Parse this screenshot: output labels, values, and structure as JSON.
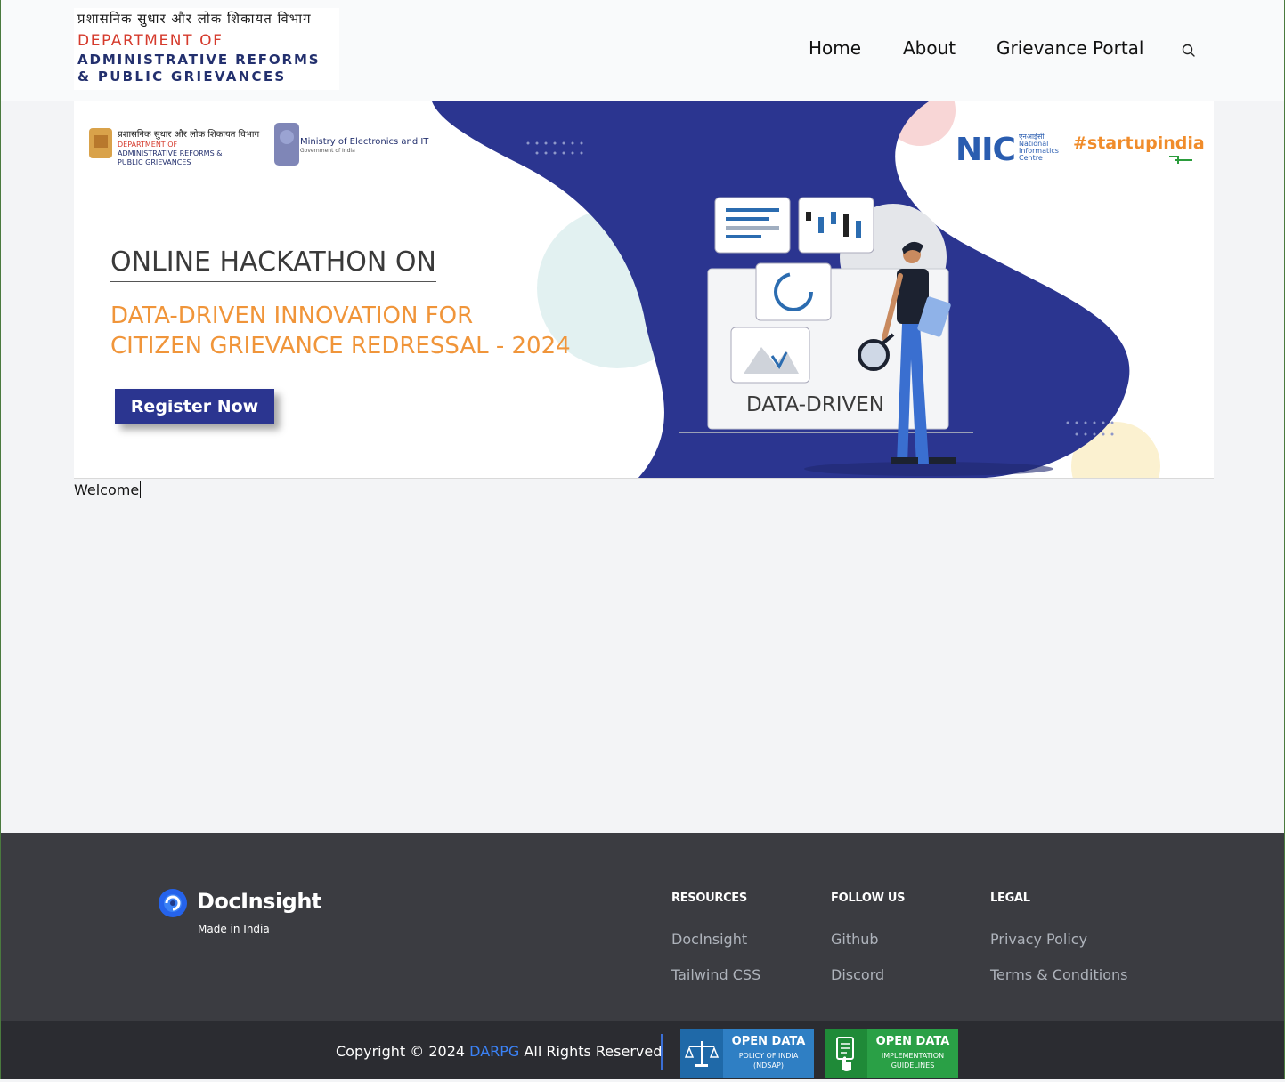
{
  "header": {
    "logo": {
      "hindi": "प्रशासनिक सुधार और लोक शिकायत विभाग",
      "line1": "DEPARTMENT OF",
      "line2": "ADMINISTRATIVE REFORMS",
      "line3": "& PUBLIC GRIEVANCES"
    },
    "nav": [
      "Home",
      "About",
      "Grievance Portal"
    ],
    "search_icon": "search-icon"
  },
  "banner": {
    "dept_hindi": "प्रशासनिक सुधार और लोक शिकायत विभाग",
    "dept_line1": "DEPARTMENT OF",
    "dept_line2": "ADMINISTRATIVE REFORMS &",
    "dept_line3": "PUBLIC GRIEVANCES",
    "ministry": "Ministry of Electronics and IT",
    "ministry_sub": "Government of India",
    "nic": "NIC",
    "nic_sub": [
      "एनआईसी",
      "National",
      "Informatics",
      "Centre"
    ],
    "startup": "#startupindia",
    "heading": "ONLINE HACKATHON ON",
    "subheading_line1": "DATA-DRIVEN INNOVATION FOR",
    "subheading_line2": "CITIZEN GRIEVANCE REDRESSAL - 2024",
    "register_button": "Register Now",
    "illustration_label": "DATA-DRIVEN"
  },
  "main": {
    "welcome": "Welcome"
  },
  "footer": {
    "brand": "DocInsight",
    "tagline": "Made in India",
    "columns": [
      {
        "heading": "RESOURCES",
        "links": [
          "DocInsight",
          "Tailwind CSS"
        ]
      },
      {
        "heading": "FOLLOW US",
        "links": [
          "Github",
          "Discord"
        ]
      },
      {
        "heading": "LEGAL",
        "links": [
          "Privacy Policy",
          "Terms & Conditions"
        ]
      }
    ],
    "copyright_prefix": "Copyright © 2024",
    "copyright_brand": "DARPG",
    "copyright_suffix": "All Rights Reserved",
    "badges": [
      {
        "title": "OPEN DATA",
        "line1": "POLICY OF INDIA",
        "line2": "(NDSAP)",
        "icon": "scales-icon"
      },
      {
        "title": "OPEN DATA",
        "line1": "IMPLEMENTATION",
        "line2": "GUIDELINES",
        "icon": "document-hand-icon"
      }
    ]
  },
  "colors": {
    "banner_blue": "#2b3590",
    "accent_orange": "#f0953a",
    "footer_bg": "#3b3c41",
    "bottom_bg": "#2b2c31",
    "link_blue": "#3b82f6"
  }
}
